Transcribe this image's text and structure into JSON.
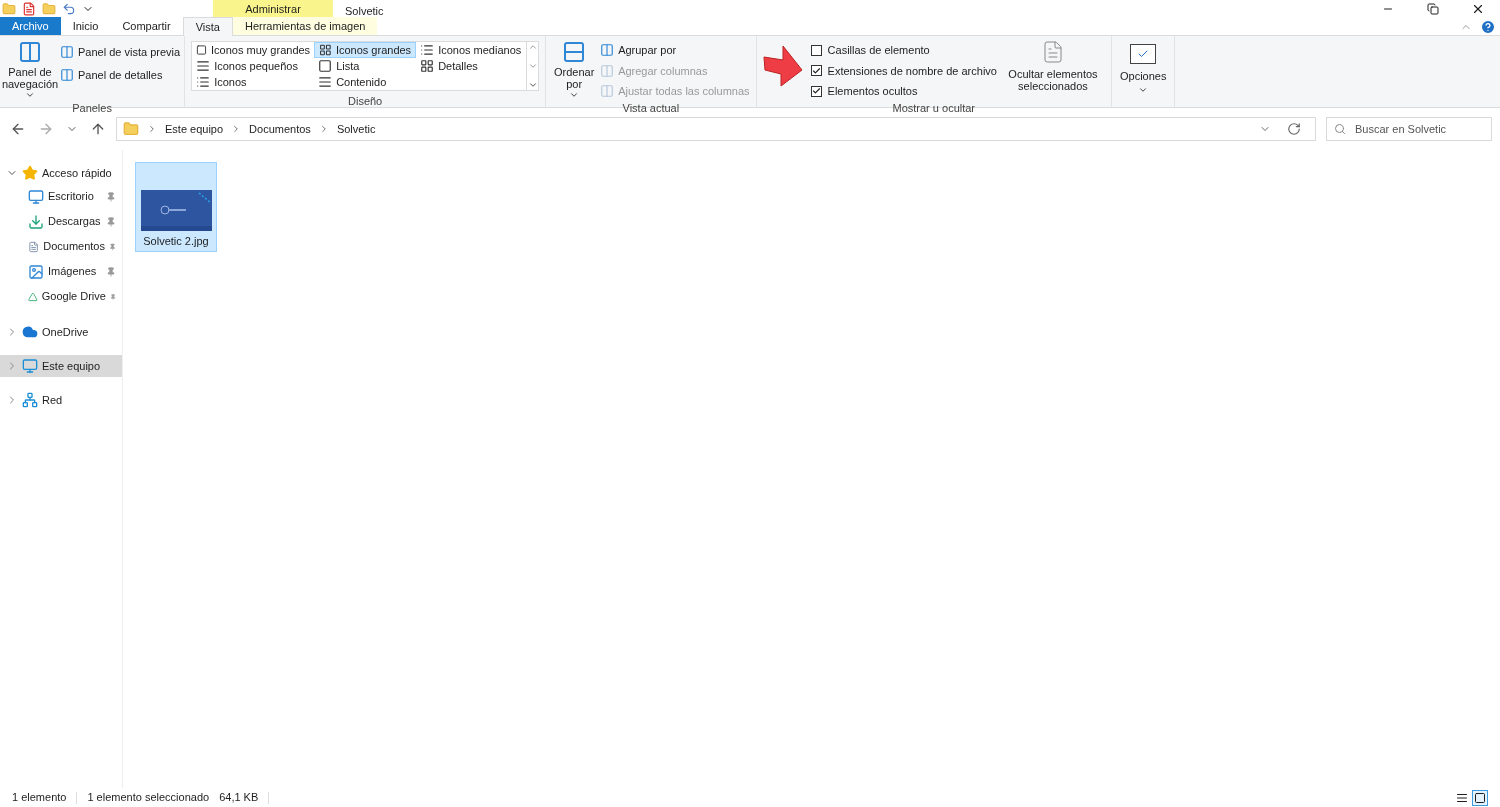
{
  "window": {
    "title": "Solvetic",
    "context_tab": "Administrar"
  },
  "tabs": [
    {
      "label": "Archivo",
      "kind": "file",
      "selected": false
    },
    {
      "label": "Inicio",
      "kind": "tab",
      "selected": false
    },
    {
      "label": "Compartir",
      "kind": "tab",
      "selected": false
    },
    {
      "label": "Vista",
      "kind": "tab",
      "selected": true
    },
    {
      "label": "Herramientas de imagen",
      "kind": "context",
      "selected": false
    }
  ],
  "ribbon": {
    "panes": {
      "title": "Paneles",
      "nav_pane": "Panel de navegación",
      "items": [
        "Panel de vista previa",
        "Panel de detalles"
      ]
    },
    "layout": {
      "title": "Diseño",
      "options": [
        {
          "label": "Iconos muy grandes",
          "selected": false
        },
        {
          "label": "Iconos grandes",
          "selected": true
        },
        {
          "label": "Iconos medianos",
          "selected": false
        },
        {
          "label": "Iconos pequeños",
          "selected": false
        },
        {
          "label": "Lista",
          "selected": false
        },
        {
          "label": "Detalles",
          "selected": false
        },
        {
          "label": "Iconos",
          "selected": false
        },
        {
          "label": "Contenido",
          "selected": false
        }
      ]
    },
    "current_view": {
      "title": "Vista actual",
      "sort": "Ordenar por",
      "items": [
        {
          "label": "Agrupar por",
          "disabled": false
        },
        {
          "label": "Agregar columnas",
          "disabled": true
        },
        {
          "label": "Ajustar todas las columnas",
          "disabled": true
        }
      ]
    },
    "show_hide": {
      "title": "Mostrar u ocultar",
      "checkboxes": [
        {
          "label": "Casillas de elemento",
          "checked": false
        },
        {
          "label": "Extensiones de nombre de archivo",
          "checked": true
        },
        {
          "label": "Elementos ocultos",
          "checked": true
        }
      ],
      "hide_button": "Ocultar elementos seleccionados"
    },
    "options": "Opciones"
  },
  "address": {
    "breadcrumbs": [
      "Este equipo",
      "Documentos",
      "Solvetic"
    ],
    "search_placeholder": "Buscar en Solvetic"
  },
  "nav": [
    {
      "label": "Acceso rápido",
      "expanded": true,
      "selected": false,
      "children": [
        {
          "label": "Escritorio",
          "selected": false
        },
        {
          "label": "Descargas",
          "selected": false
        },
        {
          "label": "Documentos",
          "selected": false
        },
        {
          "label": "Imágenes",
          "selected": false
        },
        {
          "label": "Google Drive",
          "selected": false
        }
      ]
    },
    {
      "label": "OneDrive",
      "expanded": false,
      "selected": false
    },
    {
      "label": "Este equipo",
      "expanded": false,
      "selected": true
    },
    {
      "label": "Red",
      "expanded": false,
      "selected": false
    }
  ],
  "files": [
    {
      "name": "Solvetic 2.jpg",
      "selected": true
    }
  ],
  "status_bar": {
    "count": "1 elemento",
    "selection": "1 elemento seleccionado",
    "size": "64,1 KB"
  },
  "view_toggles": [
    {
      "kind": "details",
      "selected": false
    },
    {
      "kind": "large",
      "selected": true
    }
  ]
}
